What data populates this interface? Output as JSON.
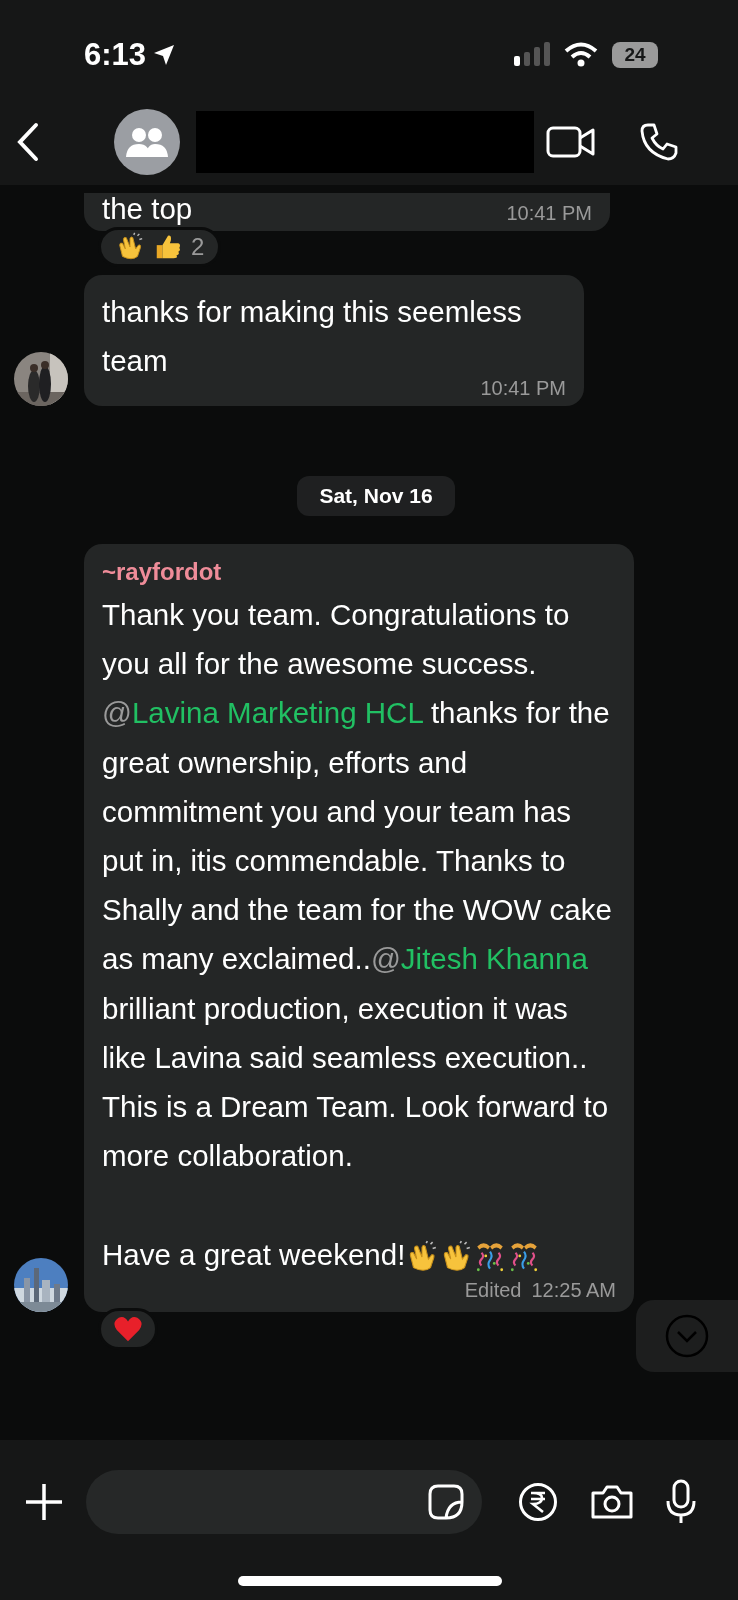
{
  "status_bar": {
    "time": "6:13",
    "battery": "24"
  },
  "messages": [
    {
      "kind": "plain",
      "text": "the top",
      "time": "10:41 PM",
      "avatar": false,
      "reactions": {
        "count": "2"
      }
    },
    {
      "kind": "plain",
      "text": "thanks for making this seemless team",
      "time": "10:41 PM",
      "avatar": true
    },
    {
      "kind": "date",
      "text": "Sat, Nov 16"
    },
    {
      "kind": "rich",
      "sender": "~rayfordot",
      "segments": [
        {
          "kind": "text",
          "text": "Thank you team. Congratulations to you all for the awesome success. "
        },
        {
          "kind": "mention",
          "at": "@",
          "name": "Lavina Marketing HCL"
        },
        {
          "kind": "text",
          "text": " thanks for the great ownership, efforts and commitment you and your team has put in, itis commendable. Thanks to Shally and the team for the WOW cake as many exclaimed.."
        },
        {
          "kind": "mention",
          "at": "@",
          "name": "Jitesh Khanna"
        },
        {
          "kind": "text",
          "text": " brilliant production, execution it was like Lavina said seamless execution..\nThis is a Dream Team. Look forward to more collaboration.\n\nHave a great weekend!"
        }
      ],
      "edited": "Edited",
      "time": "12:25 AM",
      "avatar": true,
      "heart": true
    }
  ]
}
